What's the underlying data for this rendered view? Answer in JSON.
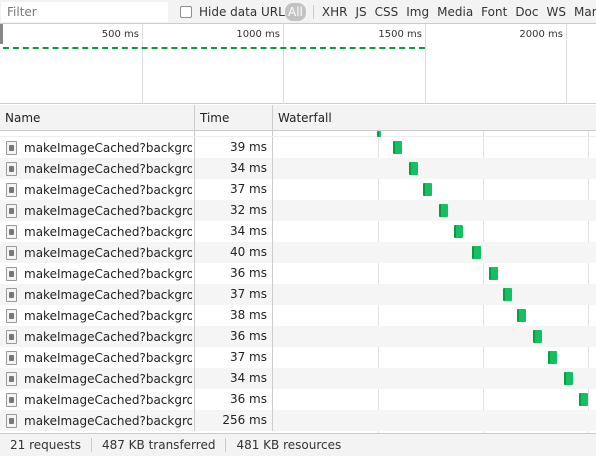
{
  "filter": {
    "placeholder": "Filter"
  },
  "hide_data_urls": {
    "label": "Hide data URLs",
    "checked": false
  },
  "types": [
    "All",
    "XHR",
    "JS",
    "CSS",
    "Img",
    "Media",
    "Font",
    "Doc",
    "WS",
    "Manif"
  ],
  "overview": {
    "labels": [
      "500 ms",
      "1000 ms",
      "1500 ms",
      "2000 ms"
    ]
  },
  "headers": {
    "name": "Name",
    "time": "Time",
    "waterfall": "Waterfall"
  },
  "rows": [
    {
      "name": "makeImageCached?backgrou...",
      "time": "39 ms"
    },
    {
      "name": "makeImageCached?backgrou...",
      "time": "34 ms"
    },
    {
      "name": "makeImageCached?backgrou...",
      "time": "37 ms"
    },
    {
      "name": "makeImageCached?backgrou...",
      "time": "32 ms"
    },
    {
      "name": "makeImageCached?backgrou...",
      "time": "34 ms"
    },
    {
      "name": "makeImageCached?backgrou...",
      "time": "40 ms"
    },
    {
      "name": "makeImageCached?backgrou...",
      "time": "36 ms"
    },
    {
      "name": "makeImageCached?backgrou...",
      "time": "37 ms"
    },
    {
      "name": "makeImageCached?backgrou...",
      "time": "38 ms"
    },
    {
      "name": "makeImageCached?backgrou...",
      "time": "36 ms"
    },
    {
      "name": "makeImageCached?backgrou...",
      "time": "37 ms"
    },
    {
      "name": "makeImageCached?backgrou...",
      "time": "34 ms"
    },
    {
      "name": "makeImageCached?backgrou...",
      "time": "36 ms"
    },
    {
      "name": "makeImageCached?backgrou...",
      "time": "256 ms"
    }
  ],
  "status": {
    "requests": "21 requests",
    "transferred": "487 KB transferred",
    "resources": "481 KB resources"
  },
  "colors": {
    "bar": "#13c162",
    "bar_edge": "#0a9d3c"
  }
}
